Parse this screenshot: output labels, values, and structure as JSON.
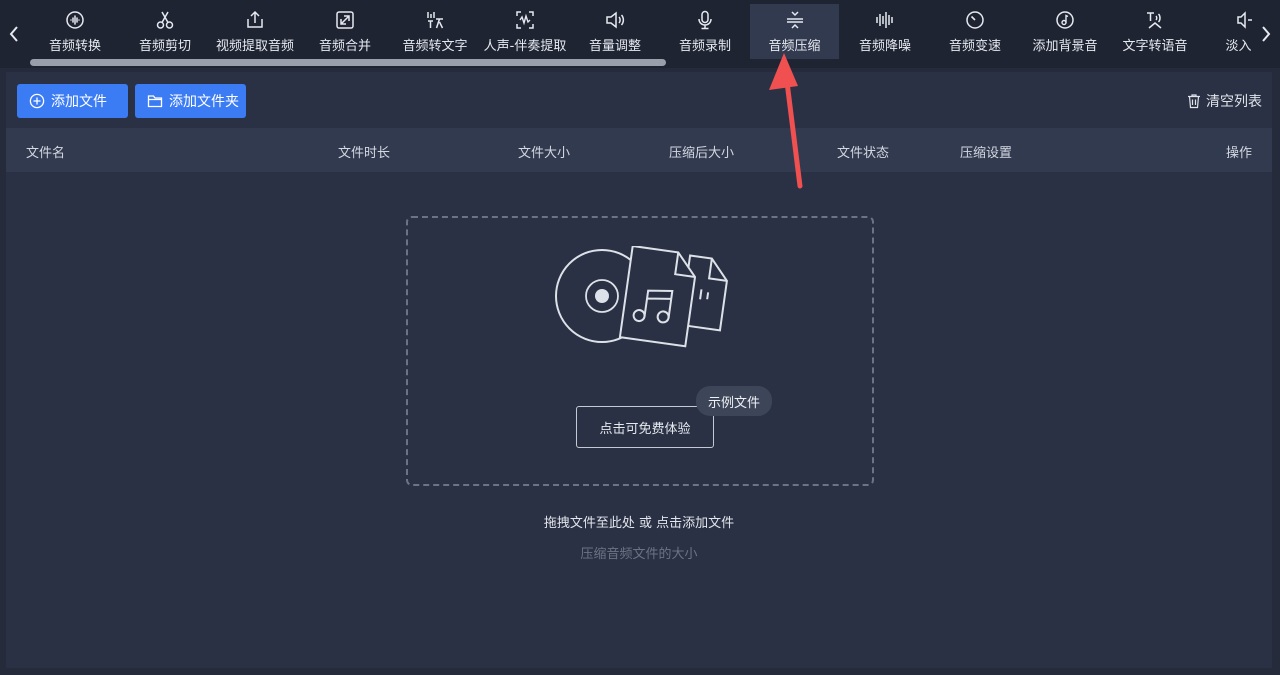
{
  "toolbar": {
    "tools": [
      {
        "label": "音频转换",
        "icon": "audio-convert-icon"
      },
      {
        "label": "音频剪切",
        "icon": "scissors-icon"
      },
      {
        "label": "视频提取音频",
        "icon": "export-icon"
      },
      {
        "label": "音频合并",
        "icon": "merge-icon"
      },
      {
        "label": "音频转文字",
        "icon": "speech-to-text-icon"
      },
      {
        "label": "人声-伴奏提取",
        "icon": "vocal-extract-icon"
      },
      {
        "label": "音量调整",
        "icon": "volume-icon"
      },
      {
        "label": "音频录制",
        "icon": "microphone-icon"
      },
      {
        "label": "音频压缩",
        "icon": "compress-icon"
      },
      {
        "label": "音频降噪",
        "icon": "denoise-icon"
      },
      {
        "label": "音频变速",
        "icon": "speed-icon"
      },
      {
        "label": "添加背景音",
        "icon": "music-note-icon"
      },
      {
        "label": "文字转语音",
        "icon": "text-to-speech-icon"
      },
      {
        "label": "淡入淡",
        "icon": "fade-icon"
      }
    ],
    "active": "音频压缩"
  },
  "actions": {
    "add_file": "添加文件",
    "add_folder": "添加文件夹",
    "clear_list": "清空列表"
  },
  "table": {
    "columns": [
      "文件名",
      "文件时长",
      "文件大小",
      "压缩后大小",
      "文件状态",
      "压缩设置",
      "操作"
    ]
  },
  "dropzone": {
    "try_button": "点击可免费体验",
    "sample_tag": "示例文件",
    "hint": "拖拽文件至此处 或 点击添加文件",
    "subhint": "压缩音频文件的大小"
  },
  "colors": {
    "accent": "#3b7cf5",
    "background": "#252b3b",
    "topbar": "#1f2433",
    "panel": "#2b3144",
    "header_row": "#323a4f",
    "annotation_arrow": "#f0504f"
  }
}
